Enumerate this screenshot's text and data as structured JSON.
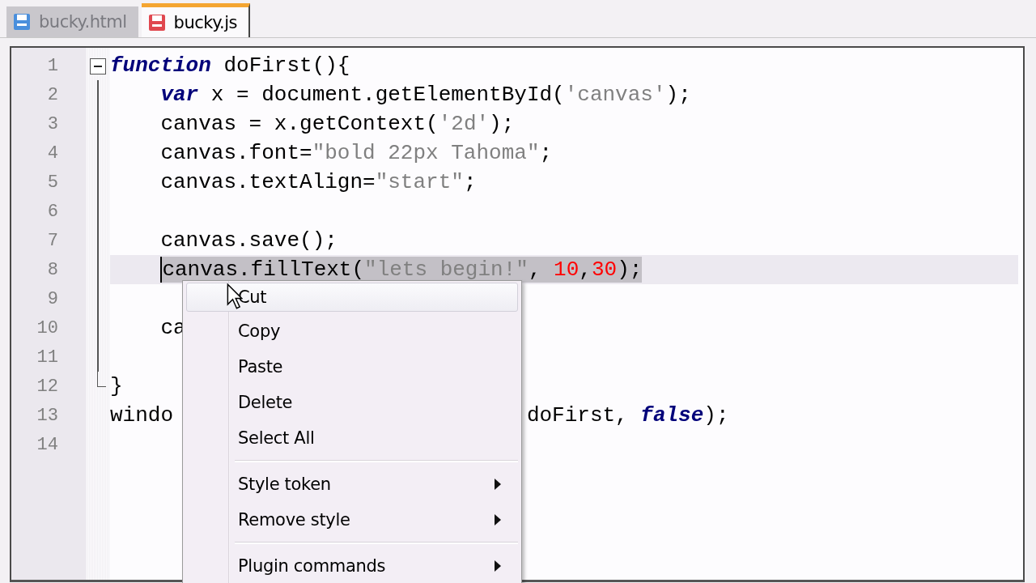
{
  "tabs": [
    {
      "label": "bucky.html",
      "selected": false,
      "color": "#4a8fdc"
    },
    {
      "label": "bucky.js",
      "selected": true,
      "color": "#e0474f"
    }
  ],
  "editor": {
    "lines": [
      {
        "number": "1",
        "indent": false,
        "current": false,
        "selected": false,
        "kind": "fold_start",
        "tokens": [
          {
            "kind": "kw",
            "text": "function"
          },
          {
            "kind": "plain",
            "text": " doFirst(){"
          }
        ]
      },
      {
        "number": "2",
        "indent": true,
        "current": false,
        "selected": false,
        "kind": "fold_body",
        "tokens": [
          {
            "kind": "kw",
            "text": "var"
          },
          {
            "kind": "plain",
            "text": " x = document.getElementById("
          },
          {
            "kind": "str",
            "text": "'canvas'"
          },
          {
            "kind": "plain",
            "text": ");"
          }
        ]
      },
      {
        "number": "3",
        "indent": true,
        "current": false,
        "selected": false,
        "kind": "fold_body",
        "tokens": [
          {
            "kind": "plain",
            "text": "canvas = x.getContext("
          },
          {
            "kind": "str",
            "text": "'2d'"
          },
          {
            "kind": "plain",
            "text": ");"
          }
        ]
      },
      {
        "number": "4",
        "indent": true,
        "current": false,
        "selected": false,
        "kind": "fold_body",
        "tokens": [
          {
            "kind": "plain",
            "text": "canvas.font="
          },
          {
            "kind": "str",
            "text": "\"bold 22px Tahoma\""
          },
          {
            "kind": "plain",
            "text": ";"
          }
        ]
      },
      {
        "number": "5",
        "indent": true,
        "current": false,
        "selected": false,
        "kind": "fold_body",
        "tokens": [
          {
            "kind": "plain",
            "text": "canvas.textAlign="
          },
          {
            "kind": "str",
            "text": "\"start\""
          },
          {
            "kind": "plain",
            "text": ";"
          }
        ]
      },
      {
        "number": "6",
        "current": false,
        "kind": "fold_body"
      },
      {
        "number": "7",
        "indent": true,
        "current": false,
        "selected": false,
        "kind": "fold_body",
        "tokens": [
          {
            "kind": "plain",
            "text": "canvas.save();"
          }
        ]
      },
      {
        "number": "8",
        "indent": true,
        "current": true,
        "selected": true,
        "kind": "fold_body",
        "tokens": [
          {
            "kind": "plain",
            "text": "canvas.fillText("
          },
          {
            "kind": "str",
            "text": "\"lets begin!\""
          },
          {
            "kind": "plain",
            "text": ", "
          },
          {
            "kind": "num",
            "text": "10"
          },
          {
            "kind": "plain",
            "text": ","
          },
          {
            "kind": "num",
            "text": "30"
          },
          {
            "kind": "plain",
            "text": ");"
          }
        ]
      },
      {
        "number": "9",
        "current": false,
        "kind": "fold_body"
      },
      {
        "number": "10",
        "indent": true,
        "current": false,
        "selected": false,
        "kind": "fold_body",
        "tokens": [
          {
            "kind": "plain",
            "text": "ca"
          }
        ]
      },
      {
        "number": "11",
        "current": false,
        "kind": "fold_body"
      },
      {
        "number": "12",
        "indent": false,
        "current": false,
        "selected": false,
        "kind": "fold_end",
        "tokens": [
          {
            "kind": "plain",
            "text": "}"
          }
        ]
      },
      {
        "number": "13",
        "indent": false,
        "current": false,
        "selected": false,
        "kind": "plain",
        "tokens": [
          {
            "kind": "plain",
            "text": "windo"
          },
          {
            "kind": "covered"
          },
          {
            "kind": "plain",
            "text": "doFirst, "
          },
          {
            "kind": "kw",
            "text": "false"
          },
          {
            "kind": "plain",
            "text": ");"
          }
        ]
      },
      {
        "number": "14",
        "current": false,
        "kind": "plain"
      }
    ]
  },
  "context_menu": {
    "items": [
      {
        "kind": "item",
        "label": "Cut",
        "selected": true,
        "submenu": false
      },
      {
        "kind": "item",
        "label": "Copy",
        "selected": false,
        "submenu": false
      },
      {
        "kind": "item",
        "label": "Paste",
        "selected": false,
        "submenu": false
      },
      {
        "kind": "item",
        "label": "Delete",
        "selected": false,
        "submenu": false
      },
      {
        "kind": "item",
        "label": "Select All",
        "selected": false,
        "submenu": false
      },
      {
        "kind": "separator"
      },
      {
        "kind": "item",
        "label": "Style token",
        "selected": false,
        "submenu": true
      },
      {
        "kind": "item",
        "label": "Remove style",
        "selected": false,
        "submenu": true
      },
      {
        "kind": "separator"
      },
      {
        "kind": "item",
        "label": "Plugin commands",
        "selected": false,
        "submenu": true
      }
    ]
  }
}
